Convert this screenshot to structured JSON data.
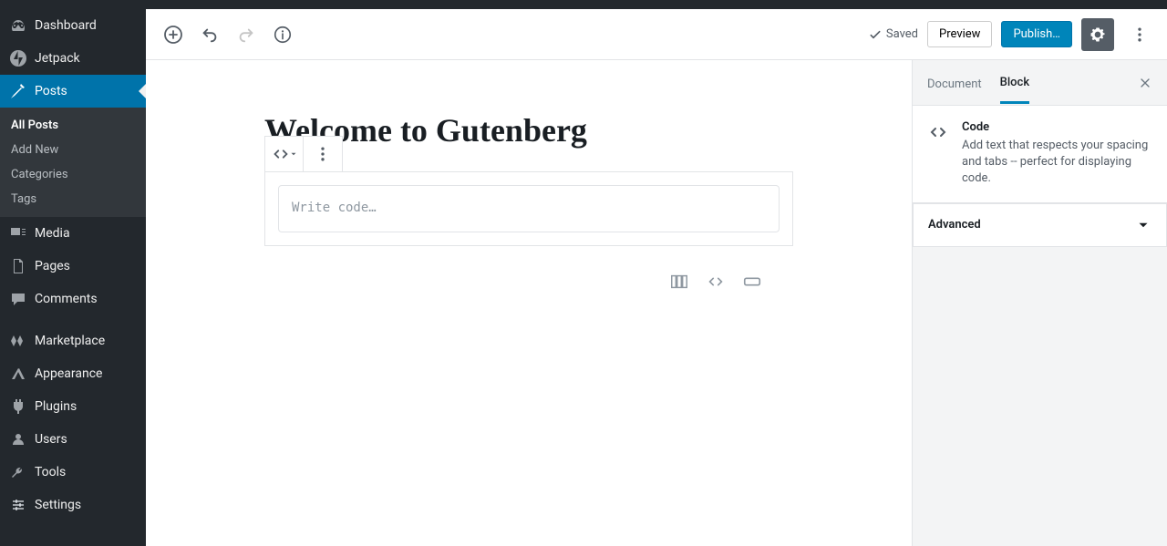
{
  "sidebar": {
    "items": [
      {
        "label": "Dashboard"
      },
      {
        "label": "Jetpack"
      },
      {
        "label": "Posts"
      },
      {
        "label": "Media"
      },
      {
        "label": "Pages"
      },
      {
        "label": "Comments"
      },
      {
        "label": "Marketplace"
      },
      {
        "label": "Appearance"
      },
      {
        "label": "Plugins"
      },
      {
        "label": "Users"
      },
      {
        "label": "Tools"
      },
      {
        "label": "Settings"
      }
    ],
    "posts_sub": [
      {
        "label": "All Posts"
      },
      {
        "label": "Add New"
      },
      {
        "label": "Categories"
      },
      {
        "label": "Tags"
      }
    ]
  },
  "header": {
    "saved": "Saved",
    "preview": "Preview",
    "publish": "Publish…"
  },
  "editor": {
    "title": "Welcome to Gutenberg",
    "code_placeholder": "Write code…"
  },
  "panel": {
    "tab_document": "Document",
    "tab_block": "Block",
    "block_name": "Code",
    "block_desc": "Add text that respects your spacing and tabs -- perfect for displaying code.",
    "advanced": "Advanced"
  }
}
